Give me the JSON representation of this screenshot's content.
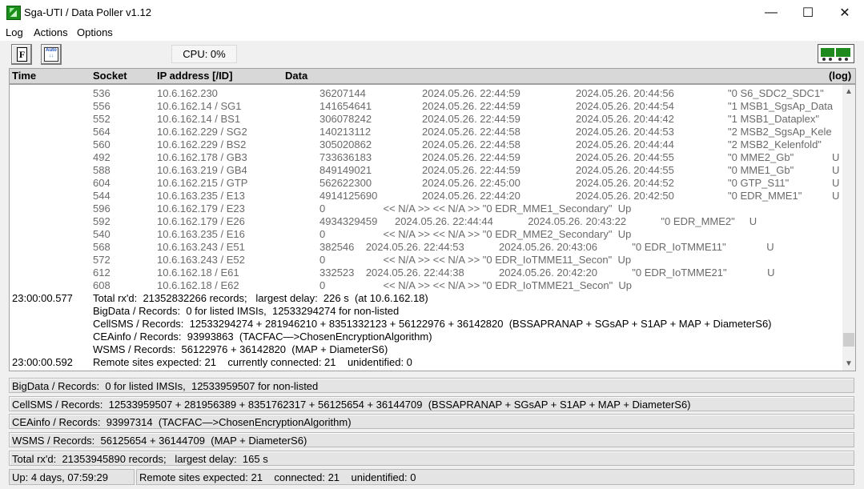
{
  "window": {
    "title": "Sga-UTI / Data Poller  v1.12"
  },
  "menu": [
    "Log",
    "Actions",
    "Options"
  ],
  "toolbar": {
    "cpu_label": "CPU:  0%",
    "f_glyph": "F",
    "auto_glyph": "Auto"
  },
  "header": {
    "time": "Time",
    "socket": "Socket",
    "ip": "IP address [/ID]",
    "data": "Data",
    "log": "(log)"
  },
  "sockets": [
    {
      "socket": "536",
      "ip": "10.6.162.230",
      "rec": "36207144",
      "t1": "2024.05.26. 22:44:59",
      "t2": "2024.05.26. 20:44:56",
      "name": "\"0 S6_SDC2_SDC1\"",
      "extra": ""
    },
    {
      "socket": "556",
      "ip": "10.6.162.14 / SG1",
      "rec": "141654641",
      "t1": "2024.05.26. 22:44:59",
      "t2": "2024.05.26. 20:44:54",
      "name": "\"1 MSB1_SgsAp_Data",
      "extra": ""
    },
    {
      "socket": "552",
      "ip": "10.6.162.14 / BS1",
      "rec": "306078242",
      "t1": "2024.05.26. 22:44:59",
      "t2": "2024.05.26. 20:44:42",
      "name": "\"1 MSB1_Dataplex\"",
      "extra": ""
    },
    {
      "socket": "564",
      "ip": "10.6.162.229 / SG2",
      "rec": "140213112",
      "t1": "2024.05.26. 22:44:58",
      "t2": "2024.05.26. 20:44:53",
      "name": "\"2 MSB2_SgsAp_Kele",
      "extra": ""
    },
    {
      "socket": "560",
      "ip": "10.6.162.229 / BS2",
      "rec": "305020862",
      "t1": "2024.05.26. 22:44:58",
      "t2": "2024.05.26. 20:44:44",
      "name": "\"2 MSB2_Kelenfold\"",
      "extra": ""
    },
    {
      "socket": "492",
      "ip": "10.6.162.178 / GB3",
      "rec": "733636183",
      "t1": "2024.05.26. 22:44:59",
      "t2": "2024.05.26. 20:44:55",
      "name": "\"0 MME2_Gb\"",
      "extra": "U"
    },
    {
      "socket": "588",
      "ip": "10.6.163.219 / GB4",
      "rec": "849149021",
      "t1": "2024.05.26. 22:44:59",
      "t2": "2024.05.26. 20:44:55",
      "name": "\"0 MME1_Gb\"",
      "extra": "U"
    },
    {
      "socket": "604",
      "ip": "10.6.162.215 / GTP",
      "rec": "562622300",
      "t1": "2024.05.26. 22:45:00",
      "t2": "2024.05.26. 20:44:52",
      "name": "\"0 GTP_S11\"",
      "extra": "U"
    },
    {
      "socket": "544",
      "ip": "10.6.163.235 / E13",
      "rec": "4914125690",
      "t1": "2024.05.26. 22:44:20",
      "t2": "2024.05.26. 20:42:50",
      "name": "\"0 EDR_MME1\"",
      "extra": "U"
    }
  ],
  "socket_rows_b": [
    {
      "socket": "596",
      "ip": "10.6.162.179 / E23",
      "rest": "0                    << N/A >> << N/A >> \"0 EDR_MME1_Secondary\"  Up"
    },
    {
      "socket": "592",
      "ip": "10.6.162.179 / E26",
      "rest": "4934329459      2024.05.26. 22:44:44            2024.05.26. 20:43:22            \"0 EDR_MME2\"     U"
    },
    {
      "socket": "540",
      "ip": "10.6.163.235 / E16",
      "rest": "0                    << N/A >> << N/A >> \"0 EDR_MME2_Secondary\"  Up"
    },
    {
      "socket": "568",
      "ip": "10.6.163.243 / E51",
      "rest": "382546    2024.05.26. 22:44:53            2024.05.26. 20:43:06            \"0 EDR_IoTMME11\"              U"
    },
    {
      "socket": "572",
      "ip": "10.6.163.243 / E52",
      "rest": "0                    << N/A >> << N/A >> \"0 EDR_IoTMME11_Secon\"  Up"
    },
    {
      "socket": "612",
      "ip": "10.6.162.18 / E61",
      "rest": "332523    2024.05.26. 22:44:38            2024.05.26. 20:42:20            \"0 EDR_IoTMME21\"              U"
    },
    {
      "socket": "608",
      "ip": "10.6.162.18 / E62",
      "rest": "0                    << N/A >> << N/A >> \"0 EDR_IoTMME21_Secon\"  Up"
    }
  ],
  "log_lines": [
    {
      "time": "23:00:00.577",
      "text": "Total rx'd:  21352832266 records;   largest delay:  226 s  (at 10.6.162.18)"
    },
    {
      "time": "",
      "text": "BigData / Records:  0 for listed IMSIs,  12533294274 for non-listed"
    },
    {
      "time": "",
      "text": "CellSMS / Records:  12533294274 + 281946210 + 8351332123 + 56122976 + 36142820  (BSSAPRANAP + SGsAP + S1AP + MAP + DiameterS6)"
    },
    {
      "time": "",
      "text": "CEAinfo / Records:  93993863  (TACFAC—>ChosenEncryptionAlgorithm)"
    },
    {
      "time": "",
      "text": "WSMS / Records:  56122976 + 36142820  (MAP + DiameterS6)"
    },
    {
      "time": "23:00:00.592",
      "text": "Remote sites expected: 21    currently connected: 21    unidentified: 0"
    }
  ],
  "status": {
    "bigdata": "BigData / Records:  0 for listed IMSIs,  12533959507 for non-listed",
    "cellsms": "CellSMS / Records:  12533959507 + 281956389 + 8351762317 + 56125654 + 36144709  (BSSAPRANAP + SGsAP + S1AP + MAP + DiameterS6)",
    "ceainfo": "CEAinfo / Records:  93997314  (TACFAC—>ChosenEncryptionAlgorithm)",
    "wsms": "WSMS / Records:  56125654 + 36144709  (MAP + DiameterS6)",
    "total": "Total rx'd:  21353945890 records;   largest delay:  165 s",
    "uptime": "Up: 4 days, 07:59:29",
    "remote": "Remote sites expected: 21    connected: 21    unidentified: 0"
  }
}
